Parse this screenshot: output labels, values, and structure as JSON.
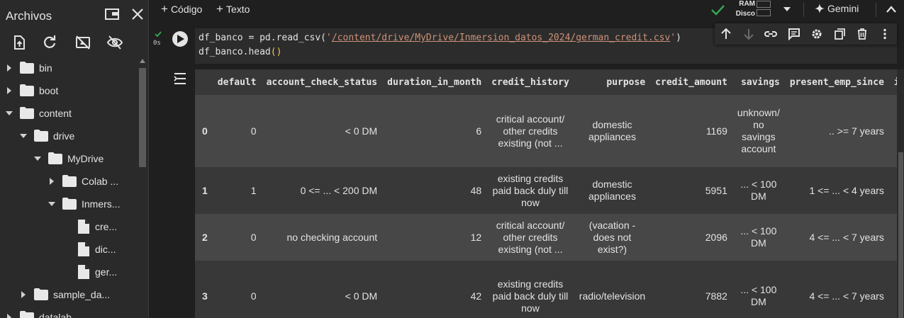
{
  "sidebar": {
    "title": "Archivos",
    "items": [
      {
        "label": "bin",
        "level": 0,
        "kind": "folder",
        "expanded": false
      },
      {
        "label": "boot",
        "level": 0,
        "kind": "folder",
        "expanded": false
      },
      {
        "label": "content",
        "level": 0,
        "kind": "folder",
        "expanded": true
      },
      {
        "label": "drive",
        "level": 1,
        "kind": "folder",
        "expanded": true
      },
      {
        "label": "MyDrive",
        "level": 2,
        "kind": "folder",
        "expanded": true
      },
      {
        "label": "Colab ...",
        "level": 3,
        "kind": "folder",
        "expanded": false
      },
      {
        "label": "Inmers...",
        "level": 3,
        "kind": "folder",
        "expanded": true
      },
      {
        "label": "cre...",
        "level": 4,
        "kind": "file"
      },
      {
        "label": "dic...",
        "level": 4,
        "kind": "file"
      },
      {
        "label": "ger...",
        "level": 4,
        "kind": "file"
      },
      {
        "label": "sample_da...",
        "level": 1,
        "kind": "folder",
        "expanded": false
      },
      {
        "label": "datalab",
        "level": 0,
        "kind": "folder",
        "expanded": false
      }
    ]
  },
  "toolbar": {
    "add_code_label": "Código",
    "add_text_label": "Texto",
    "ram_label": "RAM",
    "disk_label": "Disco",
    "ram_fraction": 0.0,
    "disk_fraction": 0.0,
    "gemini_label": "Gemini"
  },
  "cell": {
    "exec_time": "0s",
    "code_line1_prefix": "df_banco = pd.read_csv(",
    "code_line1_quote_open": "'",
    "code_line1_path": "/content/drive/MyDrive/Inmersion_datos_2024/german_credit.csv",
    "code_line1_quote_close": "'",
    "code_line1_suffix": ")",
    "code_line2_prefix": "df_banco.head",
    "code_line2_parens": "()"
  },
  "output": {
    "columns": [
      "",
      "default",
      "account_check_status",
      "duration_in_month",
      "credit_history",
      "purpose",
      "credit_amount",
      "savings",
      "present_emp_since",
      "in"
    ],
    "rows": [
      {
        "index": "0",
        "cells": [
          "0",
          "< 0 DM",
          "6",
          [
            "critical account/",
            "other credits",
            "existing (not ..."
          ],
          [
            "domestic",
            "appliances"
          ],
          "1169",
          [
            "unknown/",
            "no",
            "savings",
            "account"
          ],
          ".. >= 7 years"
        ]
      },
      {
        "index": "1",
        "cells": [
          "1",
          "0 <= ... < 200 DM",
          "48",
          [
            "existing credits",
            "paid back duly till",
            "now"
          ],
          [
            "domestic",
            "appliances"
          ],
          "5951",
          [
            "... < 100",
            "DM"
          ],
          "1 <= ... < 4 years"
        ]
      },
      {
        "index": "2",
        "cells": [
          "0",
          "no checking account",
          "12",
          [
            "critical account/",
            "other credits",
            "existing (not ..."
          ],
          [
            "(vacation -",
            "does not",
            "exist?)"
          ],
          "2096",
          [
            "... < 100",
            "DM"
          ],
          "4 <= ... < 7 years"
        ]
      },
      {
        "index": "3",
        "cells": [
          "0",
          "< 0 DM",
          "42",
          [
            "existing credits",
            "paid back duly till",
            "now"
          ],
          "radio/television",
          "7882",
          [
            "... < 100",
            "DM"
          ],
          "4 <= ... < 7 years"
        ]
      }
    ]
  },
  "colors": {
    "background": "#1f1f1f",
    "sidebar": "#2a2a2a",
    "code_bg": "#2c2c2c",
    "string": "#ce9178",
    "paren": "#f2c85b",
    "check_green": "#34a853"
  }
}
